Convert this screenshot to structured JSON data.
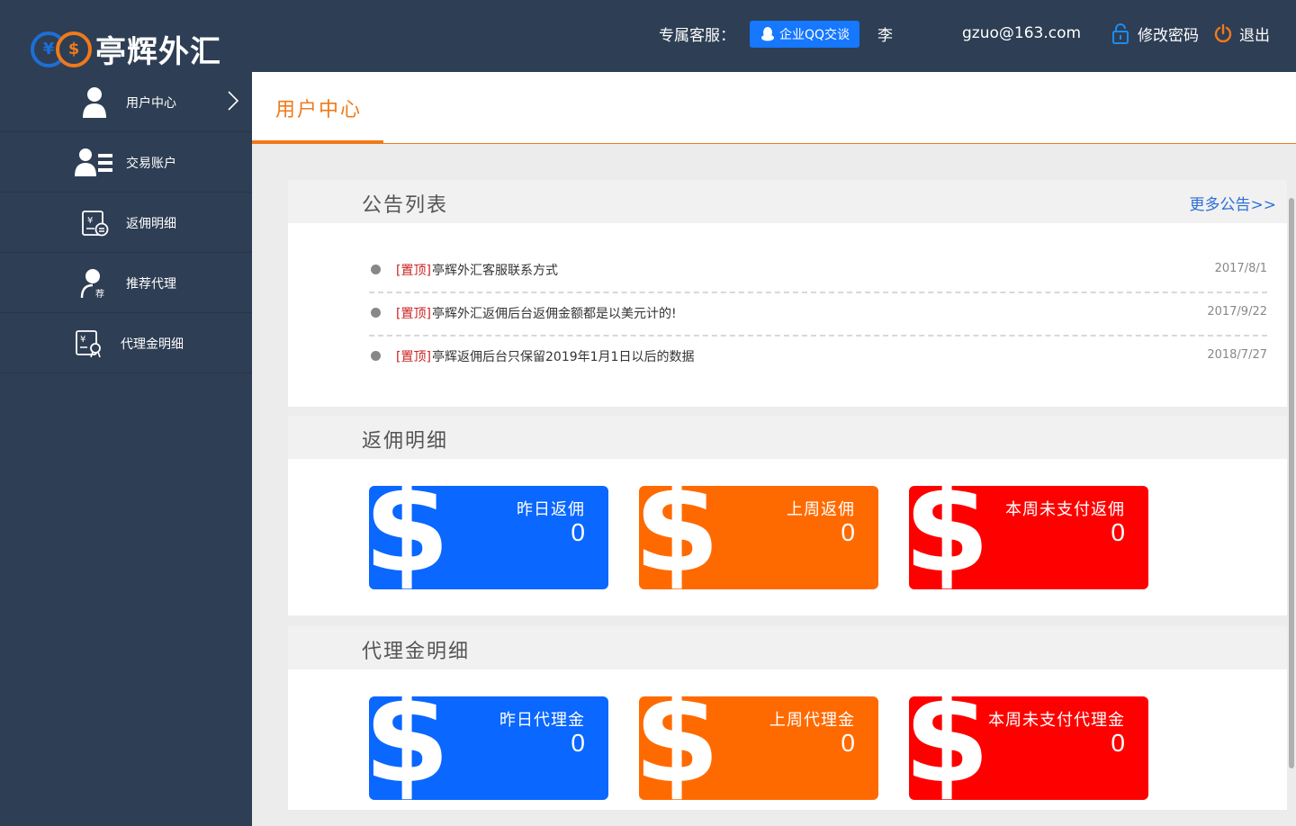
{
  "header": {
    "logo_text": "亭辉外汇",
    "logo_symbol_1": "¥",
    "logo_symbol_2": "$",
    "service_label": "专属客服：",
    "qq_button": "企业QQ交谈",
    "username": "李",
    "email": "gzuo@163.com",
    "change_password": "修改密码",
    "logout": "退出"
  },
  "sidebar": {
    "items": [
      {
        "label": "用户中心",
        "icon": "user-icon"
      },
      {
        "label": "交易账户",
        "icon": "account-list-icon"
      },
      {
        "label": "返佣明细",
        "icon": "rebate-detail-icon"
      },
      {
        "label": "推荐代理",
        "icon": "recommend-agent-icon"
      },
      {
        "label": "代理金明细",
        "icon": "agent-fund-icon"
      }
    ]
  },
  "page": {
    "title": "用户中心"
  },
  "notices": {
    "title": "公告列表",
    "more": "更多公告>>",
    "items": [
      {
        "tag": "[置顶]",
        "title": "亭辉外汇客服联系方式",
        "date": "2017/8/1"
      },
      {
        "tag": "[置顶]",
        "title": "亭辉外汇返佣后台返佣金额都是以美元计的!",
        "date": "2017/9/22"
      },
      {
        "tag": "[置顶]",
        "title": "亭辉返佣后台只保留2019年1月1日以后的数据",
        "date": "2018/7/27"
      }
    ]
  },
  "rebate": {
    "title": "返佣明细",
    "cards": [
      {
        "label": "昨日返佣",
        "value": "0",
        "color": "#0a67ff"
      },
      {
        "label": "上周返佣",
        "value": "0",
        "color": "#ff6a00"
      },
      {
        "label": "本周未支付返佣",
        "value": "0",
        "color": "#ff0000"
      }
    ]
  },
  "agent": {
    "title": "代理金明细",
    "cards": [
      {
        "label": "昨日代理金",
        "value": "0",
        "color": "#0a67ff"
      },
      {
        "label": "上周代理金",
        "value": "0",
        "color": "#ff6a00"
      },
      {
        "label": "本周未支付代理金",
        "value": "0",
        "color": "#ff0000"
      }
    ]
  },
  "card_symbol": "$"
}
